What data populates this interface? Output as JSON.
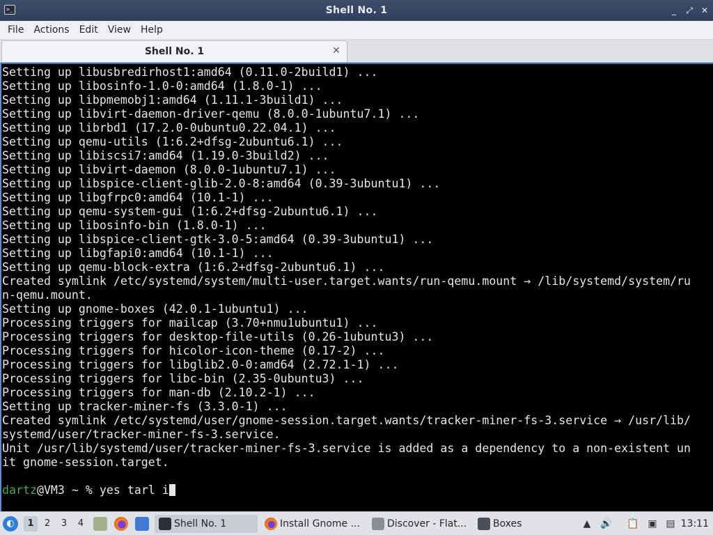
{
  "window": {
    "title": "Shell No. 1",
    "minimize": "_",
    "maximize": "⤢",
    "close": "✕"
  },
  "menu": [
    "File",
    "Actions",
    "Edit",
    "View",
    "Help"
  ],
  "tab": {
    "label": "Shell No. 1",
    "close": "✕"
  },
  "terminal": {
    "lines": [
      "Setting up libusbredirhost1:amd64 (0.11.0-2build1) ...",
      "Setting up libosinfo-1.0-0:amd64 (1.8.0-1) ...",
      "Setting up libpmemobj1:amd64 (1.11.1-3build1) ...",
      "Setting up libvirt-daemon-driver-qemu (8.0.0-1ubuntu7.1) ...",
      "Setting up librbd1 (17.2.0-0ubuntu0.22.04.1) ...",
      "Setting up qemu-utils (1:6.2+dfsg-2ubuntu6.1) ...",
      "Setting up libiscsi7:amd64 (1.19.0-3build2) ...",
      "Setting up libvirt-daemon (8.0.0-1ubuntu7.1) ...",
      "Setting up libspice-client-glib-2.0-8:amd64 (0.39-3ubuntu1) ...",
      "Setting up libgfrpc0:amd64 (10.1-1) ...",
      "Setting up qemu-system-gui (1:6.2+dfsg-2ubuntu6.1) ...",
      "Setting up libosinfo-bin (1.8.0-1) ...",
      "Setting up libspice-client-gtk-3.0-5:amd64 (0.39-3ubuntu1) ...",
      "Setting up libgfapi0:amd64 (10.1-1) ...",
      "Setting up qemu-block-extra (1:6.2+dfsg-2ubuntu6.1) ...",
      "Created symlink /etc/systemd/system/multi-user.target.wants/run-qemu.mount → /lib/systemd/system/ru",
      "n-qemu.mount.",
      "Setting up gnome-boxes (42.0.1-1ubuntu1) ...",
      "Processing triggers for mailcap (3.70+nmu1ubuntu1) ...",
      "Processing triggers for desktop-file-utils (0.26-1ubuntu3) ...",
      "Processing triggers for hicolor-icon-theme (0.17-2) ...",
      "Processing triggers for libglib2.0-0:amd64 (2.72.1-1) ...",
      "Processing triggers for libc-bin (2.35-0ubuntu3) ...",
      "Processing triggers for man-db (2.10.2-1) ...",
      "Setting up tracker-miner-fs (3.3.0-1) ...",
      "Created symlink /etc/systemd/user/gnome-session.target.wants/tracker-miner-fs-3.service → /usr/lib/",
      "systemd/user/tracker-miner-fs-3.service.",
      "Unit /usr/lib/systemd/user/tracker-miner-fs-3.service is added as a dependency to a non-existent un",
      "it gnome-session.target.",
      ""
    ],
    "prompt_user": "dartz",
    "prompt_rest": "@VM3 ~ % ",
    "command": "yes tarl i"
  },
  "taskbar": {
    "workspaces": [
      "1",
      "2",
      "3",
      "4"
    ],
    "tasks": [
      {
        "label": "Shell No. 1",
        "icon": "terminal-icon",
        "color": "#2b2f36"
      },
      {
        "label": "Install Gnome ...",
        "icon": "firefox-icon",
        "color": "#e66b1a"
      },
      {
        "label": "Discover - Flat...",
        "icon": "discover-icon",
        "color": "#8a8f96"
      },
      {
        "label": "Boxes",
        "icon": "boxes-icon",
        "color": "#4a4f57"
      }
    ],
    "clock": "13:11"
  },
  "colors": {
    "titlebar": "#34456a",
    "terminal_bg": "#000000",
    "terminal_fg": "#e6e6e6",
    "prompt_user": "#4aa84a",
    "accent": "#3a6fb5"
  }
}
